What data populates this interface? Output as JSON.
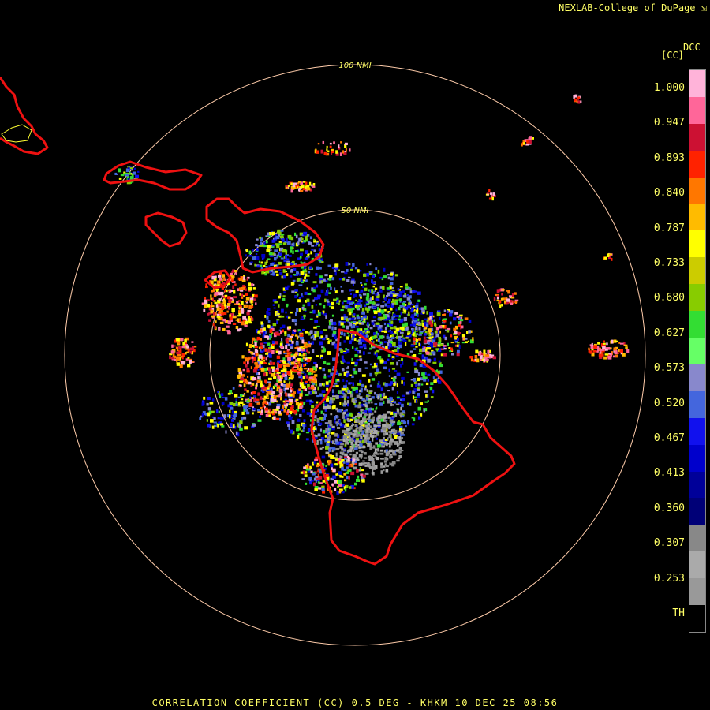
{
  "credit": "NEXLAB-College of DuPage",
  "footer": "CORRELATION COEFFICIENT (CC) 0.5 DEG - KHKM 10 DEC 25 08:56",
  "product_code": "DCC",
  "unit_label": "[CC]",
  "range_rings": [
    {
      "label": "100 NMI",
      "nm": 100
    },
    {
      "label": "50 NMI",
      "nm": 50
    }
  ],
  "colorbar": {
    "labels": [
      "1.000",
      "0.947",
      "0.893",
      "0.840",
      "0.787",
      "0.733",
      "0.680",
      "0.627",
      "0.573",
      "0.520",
      "0.467",
      "0.413",
      "0.360",
      "0.307",
      "0.253",
      "TH"
    ],
    "colors": [
      "#ffb3d9",
      "#ff6699",
      "#cc1133",
      "#ff2200",
      "#ff7700",
      "#ffbb00",
      "#ffff00",
      "#cccc00",
      "#88cc00",
      "#33dd33",
      "#66ff66",
      "#8888cc",
      "#4466dd",
      "#1111ee",
      "#0000cc",
      "#000099",
      "#000077",
      "#888888",
      "#aaaaaa",
      "#999999",
      "#000000"
    ]
  },
  "map_colors": {
    "coast": "#ee1111",
    "ring": "#ffccaa",
    "oahu_inner": "#ffff33"
  }
}
